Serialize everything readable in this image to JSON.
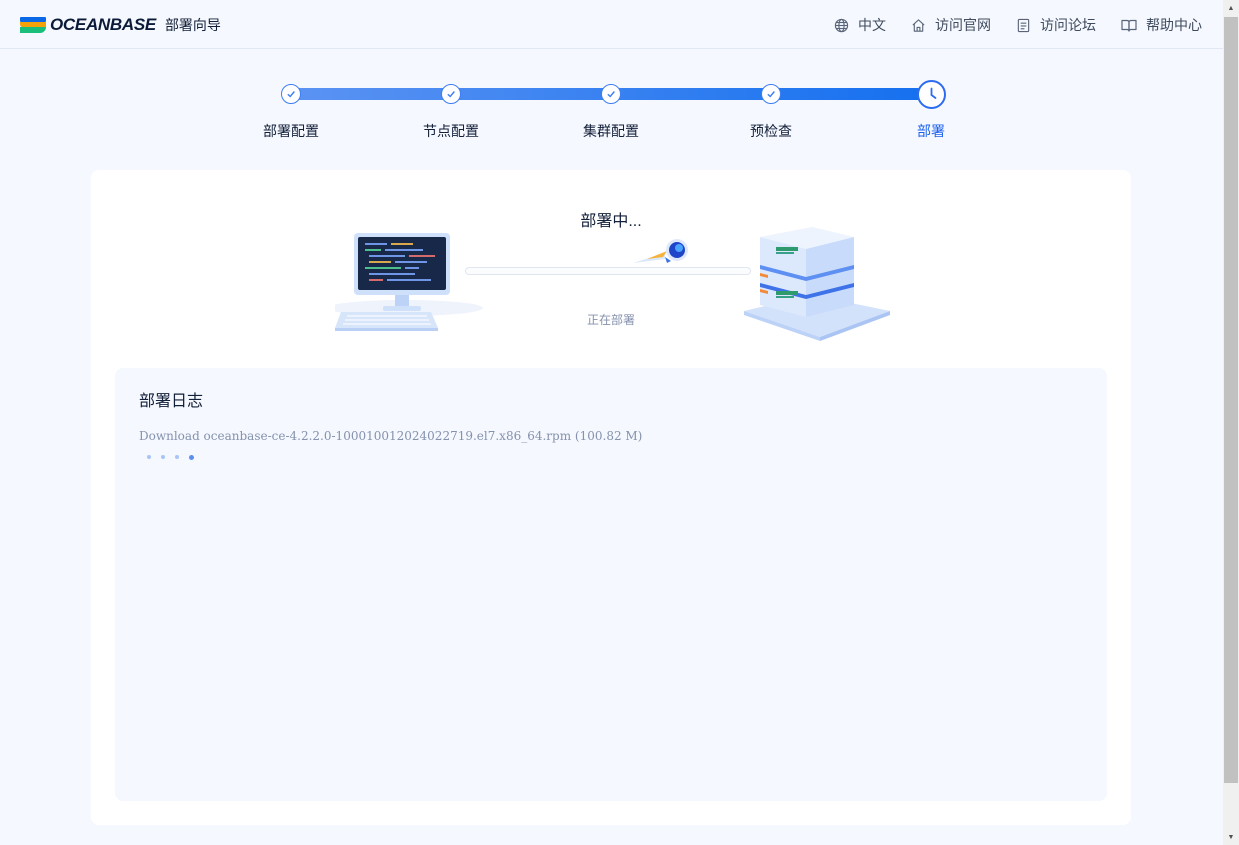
{
  "brand": {
    "logo_text": "OCEANBASE",
    "app_title": "部署向导"
  },
  "header_nav": [
    {
      "label": "中文",
      "icon": "globe-icon"
    },
    {
      "label": "访问官网",
      "icon": "home-icon"
    },
    {
      "label": "访问论坛",
      "icon": "document-icon"
    },
    {
      "label": "帮助中心",
      "icon": "book-icon"
    }
  ],
  "steps": [
    {
      "label": "部署配置",
      "status": "done"
    },
    {
      "label": "节点配置",
      "status": "done"
    },
    {
      "label": "集群配置",
      "status": "done"
    },
    {
      "label": "预检查",
      "status": "done"
    },
    {
      "label": "部署",
      "status": "current"
    }
  ],
  "deploy": {
    "title": "部署中...",
    "status_text": "正在部署",
    "progress_fraction": 0.0
  },
  "log": {
    "title": "部署日志",
    "lines": [
      "Download oceanbase-ce-4.2.2.0-100010012024022719.el7.x86_64.rpm (100.82 M)"
    ]
  },
  "colors": {
    "accent": "#1c61ee",
    "track_start": "#5b93f3",
    "track_end": "#1570ef",
    "page_bg": "#f5f8fe"
  }
}
